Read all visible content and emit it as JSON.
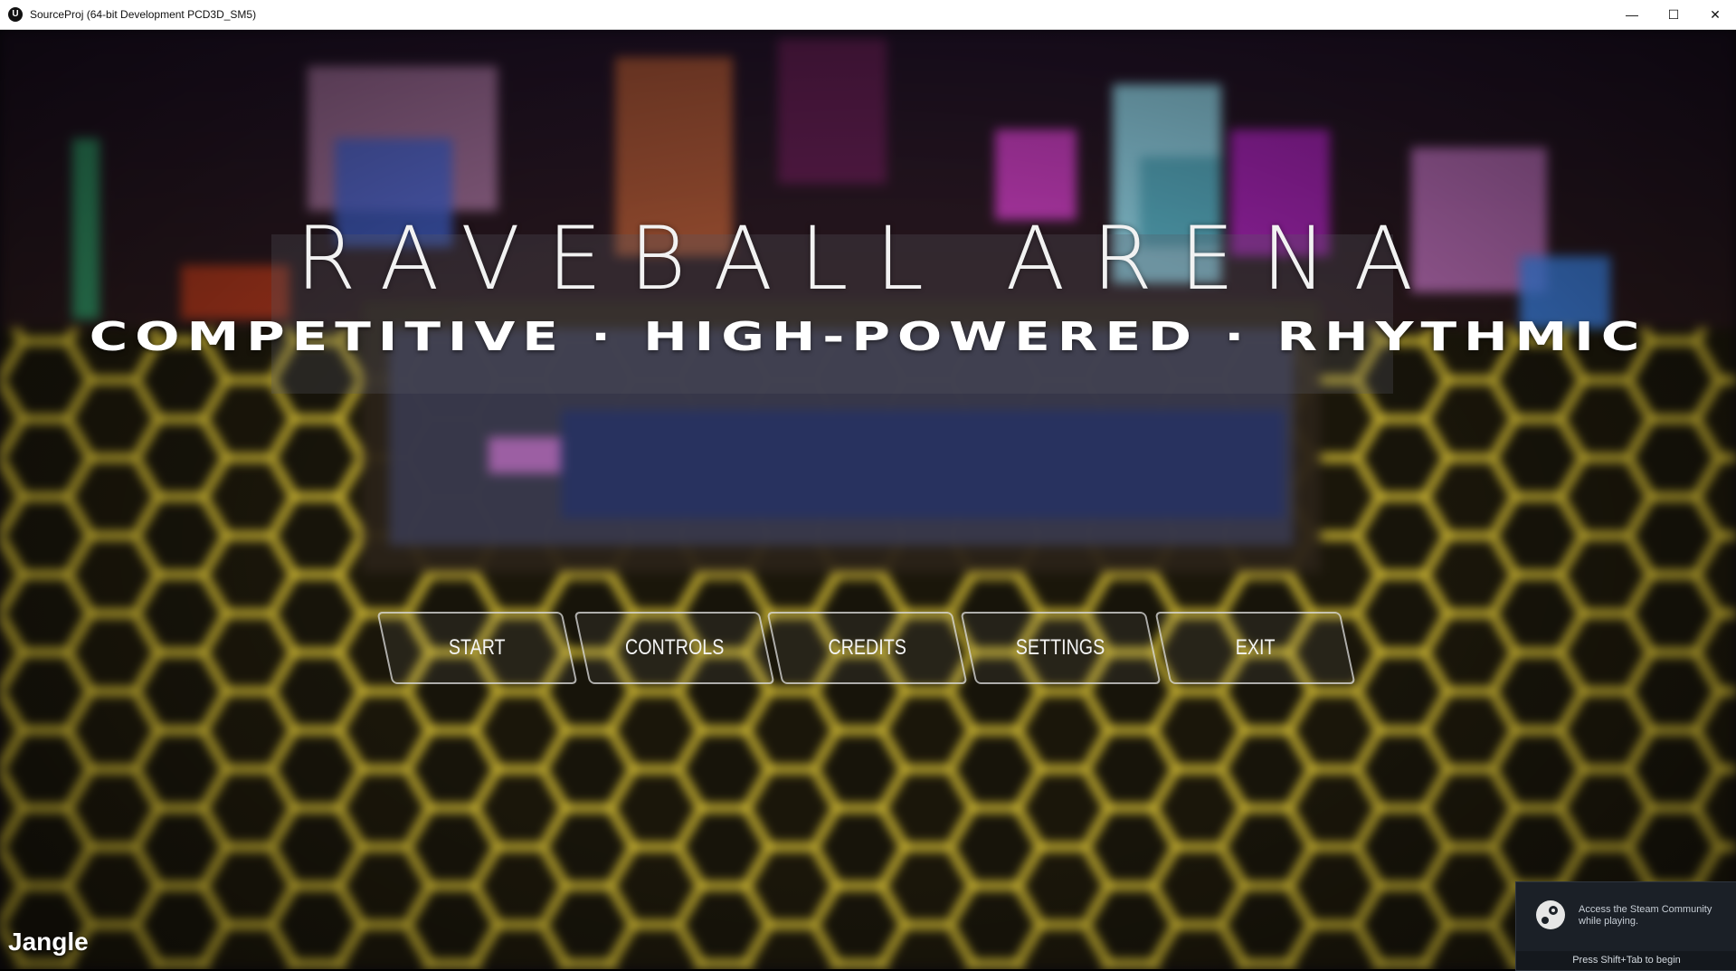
{
  "window": {
    "title": "SourceProj (64-bit Development PCD3D_SM5)",
    "minimize_glyph": "—",
    "maximize_glyph": "☐",
    "close_glyph": "✕"
  },
  "game": {
    "title": "RAVEBALL ARENA",
    "tagline": "COMPETITIVE · HIGH-POWERED · RHYTHMIC",
    "menu": [
      "START",
      "CONTROLS",
      "CREDITS",
      "SETTINGS",
      "EXIT"
    ],
    "player_name": "Jangle",
    "accent_color": "#ffe23a"
  },
  "steam_overlay": {
    "icon": "steam-icon",
    "message": "Access the Steam Community while playing.",
    "hint": "Press Shift+Tab to begin"
  }
}
